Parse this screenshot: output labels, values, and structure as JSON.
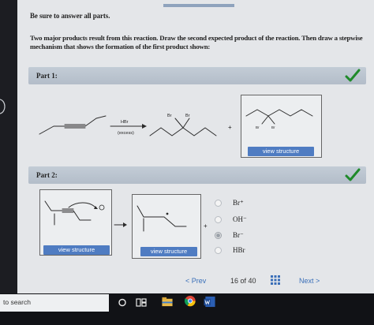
{
  "instructions": {
    "intro": "Be sure to answer all parts.",
    "question": "Two major products result from this reaction. Draw the second expected product of the reaction. Then draw a stepwise mechanism that shows the formation of the first product shown:"
  },
  "part1": {
    "label": "Part 1:",
    "reagent_top": "HBr",
    "reagent_bottom": "(excess)",
    "product_br_left": "Br",
    "product_br_right": "Br",
    "plus": "+",
    "answer_br_left": "Br",
    "answer_br_right": "Br",
    "view_button": "view structure",
    "status_color": "#1f8a2a"
  },
  "part2": {
    "label": "Part 2:",
    "arrow": "→",
    "plus": "+",
    "view_button_1": "view structure",
    "view_button_2": "view structure",
    "options": [
      {
        "label": "Br⁺",
        "selected": false
      },
      {
        "label": "OH⁻",
        "selected": false
      },
      {
        "label": "Br⁻",
        "selected": true
      },
      {
        "label": "HBr",
        "selected": false
      }
    ]
  },
  "pager": {
    "prev": "< Prev",
    "count": "16 of 40",
    "next": "Next >"
  },
  "taskbar": {
    "search": "to search"
  },
  "colors": {
    "accent": "#4f7cc2",
    "check": "#1f8a2a",
    "link": "#3a6fb8"
  }
}
